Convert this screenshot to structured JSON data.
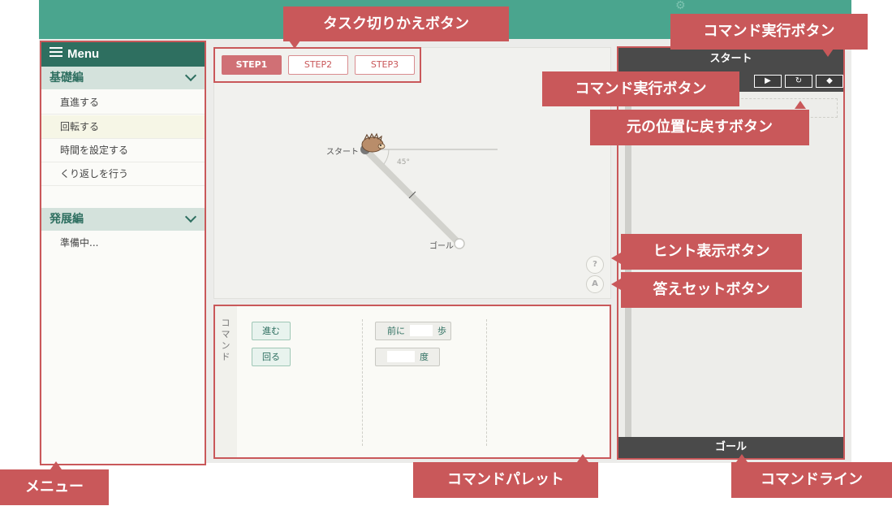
{
  "sidebar": {
    "title": "Menu",
    "sections": [
      {
        "label": "基礎編",
        "items": [
          "直進する",
          "回転する",
          "時間を設定する",
          "くり返しを行う"
        ]
      },
      {
        "label": "発展編",
        "items": [
          "準備中..."
        ]
      }
    ]
  },
  "stage": {
    "steps": [
      "STEP1",
      "STEP2",
      "STEP3"
    ],
    "start_label": "スタート",
    "goal_label": "ゴール",
    "angle_label": "45°",
    "hint_glyph": "?",
    "answer_glyph": "A"
  },
  "palette": {
    "vertical_label": "コマンド",
    "commands": [
      "進む",
      "回る"
    ],
    "forward": {
      "prefix": "前に",
      "suffix": "歩"
    },
    "turn": {
      "suffix": "度"
    }
  },
  "command_line": {
    "start_label": "スタート",
    "goal_label": "ゴール",
    "tools": [
      "play-icon",
      "reset-icon",
      "eraser-icon"
    ]
  },
  "callouts": {
    "task_switch": "タスク切りかえボタン",
    "run_top": "コマンド実行ボタン",
    "run_mid": "コマンド実行ボタン",
    "reset": "元の位置に戻すボタン",
    "hint": "ヒント表示ボタン",
    "answer": "答えセットボタン",
    "menu": "メニュー",
    "palette": "コマンドパレット",
    "command_line": "コマンドライン"
  },
  "colors": {
    "brand_green": "#4aa58e",
    "menu_header": "#2e6f60",
    "callout_red": "#c9585a"
  }
}
